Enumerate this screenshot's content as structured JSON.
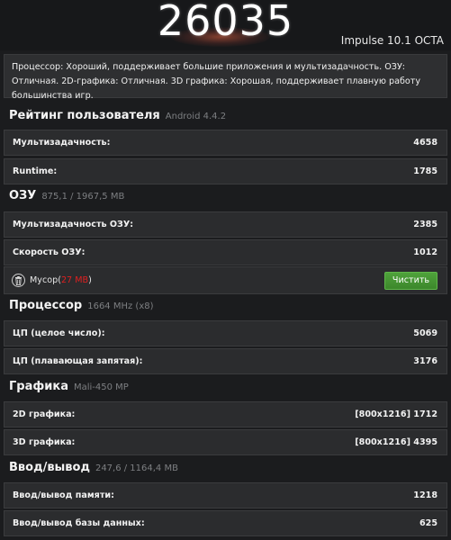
{
  "header": {
    "total_score": "26035",
    "device_name": "Impulse 10.1 OCTA"
  },
  "summary": {
    "text": "Процессор: Хороший, поддерживает большие приложения и мультизадачность. ОЗУ: Отличная. 2D-графика: Отличная. 3D графика: Хорошая, поддерживает плавную работу большинства игр."
  },
  "sections": {
    "user_rating": {
      "title": "Рейтинг пользователя",
      "subtitle": "Android 4.4.2",
      "rows": [
        {
          "label": "Мультизадачность:",
          "value": "4658"
        },
        {
          "label": "Runtime:",
          "value": "1785"
        }
      ]
    },
    "ram": {
      "title": "ОЗУ",
      "subtitle": "875,1 / 1967,5 MB",
      "rows": [
        {
          "label": "Мультизадачность ОЗУ:",
          "value": "2385"
        },
        {
          "label": "Скорость ОЗУ:",
          "value": "1012"
        }
      ],
      "junk_label": "Мусор",
      "junk_open": "(",
      "junk_size": "27 MB",
      "junk_close": ")",
      "clean_button": "Чистить"
    },
    "cpu": {
      "title": "Процессор",
      "subtitle": "1664 MHz (x8)",
      "rows": [
        {
          "label": "ЦП (целое число):",
          "value": "5069"
        },
        {
          "label": "ЦП (плавающая запятая):",
          "value": "3176"
        }
      ]
    },
    "graphics": {
      "title": "Графика",
      "subtitle": "Mali-450 MP",
      "rows": [
        {
          "label": "2D графика:",
          "value": "[800x1216] 1712"
        },
        {
          "label": "3D графика:",
          "value": "[800x1216] 4395"
        }
      ]
    },
    "io": {
      "title": "Ввод/вывод",
      "subtitle": "247,6 / 1164,4 MB",
      "rows": [
        {
          "label": "Ввод/вывод памяти:",
          "value": "1218"
        },
        {
          "label": "Ввод/вывод базы данных:",
          "value": "625"
        }
      ]
    }
  },
  "colors": {
    "background": "#1b1c1e",
    "row_background": "#2b2c2e",
    "accent_green": "#3c872b",
    "junk_red": "#e02020"
  },
  "icons": {
    "trash": "trash-icon"
  }
}
